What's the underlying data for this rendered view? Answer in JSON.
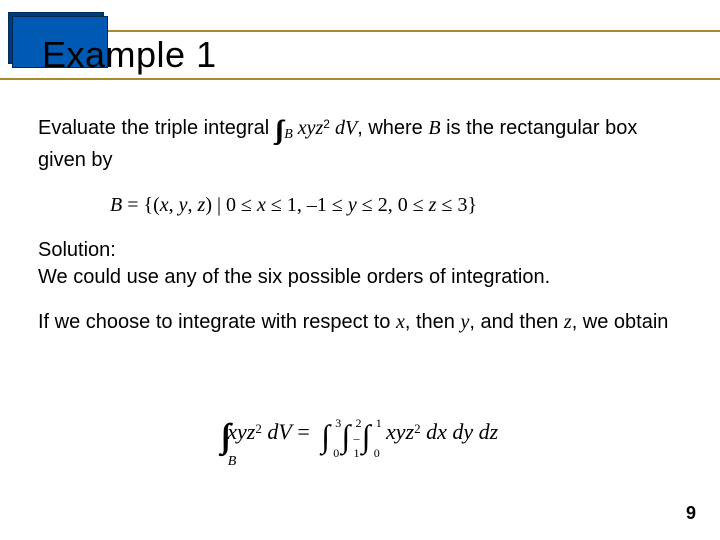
{
  "title": "Example 1",
  "body": {
    "p1_a": "Evaluate the triple integral ",
    "p1_int": "∫∫∫",
    "p1_sub": "B",
    "p1_b_i": " xyz",
    "p1_sup": "2",
    "p1_c_i": " dV",
    "p1_d": ", where ",
    "p1_e_i": "B",
    "p1_f": " is the rectangular box given by",
    "p2_a": "B",
    "p2_b": " = {(",
    "p2_c_i": "x",
    "p2_d": ", ",
    "p2_e_i": "y",
    "p2_f": ", ",
    "p2_g_i": "z",
    "p2_h": ") | 0 ≤ ",
    "p2_i_i": "x",
    "p2_j": " ≤ 1, –1 ≤ ",
    "p2_k_i": "y",
    "p2_l": " ≤ 2, 0 ≤ ",
    "p2_m_i": "z",
    "p2_n": " ≤ 3}",
    "solution_label": "Solution:",
    "p3": "We could use any of the six possible orders of integration.",
    "p4_a": "If we choose to integrate with respect to ",
    "p4_b_i": "x",
    "p4_c": ", then ",
    "p4_d_i": "y",
    "p4_e": ", and then ",
    "p4_f_i": "z",
    "p4_g": ", we obtain"
  },
  "eqn": {
    "lhs_int": "∫∫∫",
    "lhs_below": "B",
    "lhs_integrand_a": " xyz",
    "lhs_sup": "2",
    "lhs_dV": " dV",
    "eq": " = ",
    "i1_lo": "0",
    "i1_hi": "3",
    "i2_lo": "–1",
    "i2_hi": "2",
    "i3_lo": "0",
    "i3_hi": "1",
    "rhs_integrand_a": " xyz",
    "rhs_sup": "2",
    "rhs_diffs": " dx dy dz",
    "int_sym": "∫"
  },
  "page_number": "9"
}
